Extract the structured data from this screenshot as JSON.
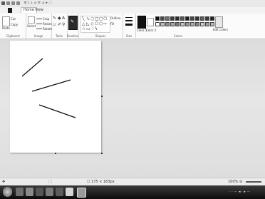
{
  "app": {
    "title": "ਰ ) ⇣ ⌂ ≡ ⊿ ▸ ⬚"
  },
  "tabs": {
    "file": "",
    "home": "Home",
    "view": "View"
  },
  "ribbon": {
    "clipboard": {
      "paste": "Paste",
      "cut": "Cut",
      "copy": "Copy",
      "label": "Clipboard"
    },
    "image": {
      "select": "Select",
      "crop": "Crop",
      "resize": "Resize",
      "rotate": "Rotate",
      "label": "Image"
    },
    "tools": {
      "label": "Tools"
    },
    "brushes": {
      "label": "Brushes"
    },
    "shapes": {
      "outline": "Outline",
      "fill": "Fill",
      "label": "Shapes"
    },
    "size": {
      "label": "Size"
    },
    "colors": {
      "color1": "Color 1",
      "color2": "Color 2",
      "edit": "Edit colors",
      "label": "Colors",
      "row1": [
        "#111111",
        "#4a4a4a",
        "#6b6b6b",
        "#3b3b3b",
        "#2a2a2a",
        "#555555",
        "#1e1e1e",
        "#474747",
        "#2f2f2f",
        "#5e5e5e",
        "#3a3a3a",
        "#222222"
      ],
      "row2": [
        "#ffffff",
        "#bdbdbd",
        "#8c8c8c",
        "#a5a5a5",
        "#7a7a7a",
        "#c4c4c4",
        "#969696",
        "#b0b0b0",
        "#868686",
        "#d0d0d0",
        "#9e9e9e",
        "#b8b8b8"
      ]
    }
  },
  "status": {
    "pos": "✥",
    "sel": "⬚",
    "size": "☐ 175 × 163px",
    "zoom": "100% ⊖"
  },
  "taskbar": {
    "clock": "· · ⋯ ◂ · ▸ ⋯"
  }
}
